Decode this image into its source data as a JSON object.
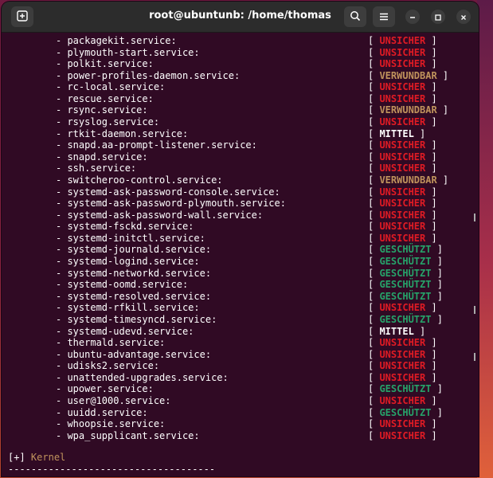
{
  "window": {
    "title": "root@ubuntunb: /home/thomas"
  },
  "icons": {
    "new_tab": "new-tab-icon",
    "search": "search-icon",
    "menu": "hamburger-menu-icon",
    "minimize": "minimize-icon",
    "maximize": "maximize-icon",
    "close": "close-icon"
  },
  "colors": {
    "terminal_bg": "#300a24",
    "unsicher": "#e01b24",
    "verwundbar": "#c0935c",
    "geschuetzt": "#26a269",
    "mittel": "#ffffff"
  },
  "services": [
    {
      "name": "- packagekit.service:",
      "status": "UNSICHER"
    },
    {
      "name": "- plymouth-start.service:",
      "status": "UNSICHER"
    },
    {
      "name": "- polkit.service:",
      "status": "UNSICHER"
    },
    {
      "name": "- power-profiles-daemon.service:",
      "status": "VERWUNDBAR"
    },
    {
      "name": "- rc-local.service:",
      "status": "UNSICHER"
    },
    {
      "name": "- rescue.service:",
      "status": "UNSICHER"
    },
    {
      "name": "- rsync.service:",
      "status": "VERWUNDBAR"
    },
    {
      "name": "- rsyslog.service:",
      "status": "UNSICHER"
    },
    {
      "name": "- rtkit-daemon.service:",
      "status": "MITTEL"
    },
    {
      "name": "- snapd.aa-prompt-listener.service:",
      "status": "UNSICHER"
    },
    {
      "name": "- snapd.service:",
      "status": "UNSICHER"
    },
    {
      "name": "- ssh.service:",
      "status": "UNSICHER"
    },
    {
      "name": "- switcheroo-control.service:",
      "status": "VERWUNDBAR"
    },
    {
      "name": "- systemd-ask-password-console.service:",
      "status": "UNSICHER"
    },
    {
      "name": "- systemd-ask-password-plymouth.service:",
      "status": "UNSICHER"
    },
    {
      "name": "- systemd-ask-password-wall.service:",
      "status": "UNSICHER"
    },
    {
      "name": "- systemd-fsckd.service:",
      "status": "UNSICHER"
    },
    {
      "name": "- systemd-initctl.service:",
      "status": "UNSICHER"
    },
    {
      "name": "- systemd-journald.service:",
      "status": "GESCHÜTZT"
    },
    {
      "name": "- systemd-logind.service:",
      "status": "GESCHÜTZT"
    },
    {
      "name": "- systemd-networkd.service:",
      "status": "GESCHÜTZT"
    },
    {
      "name": "- systemd-oomd.service:",
      "status": "GESCHÜTZT"
    },
    {
      "name": "- systemd-resolved.service:",
      "status": "GESCHÜTZT"
    },
    {
      "name": "- systemd-rfkill.service:",
      "status": "UNSICHER"
    },
    {
      "name": "- systemd-timesyncd.service:",
      "status": "GESCHÜTZT"
    },
    {
      "name": "- systemd-udevd.service:",
      "status": "MITTEL"
    },
    {
      "name": "- thermald.service:",
      "status": "UNSICHER"
    },
    {
      "name": "- ubuntu-advantage.service:",
      "status": "UNSICHER"
    },
    {
      "name": "- udisks2.service:",
      "status": "UNSICHER"
    },
    {
      "name": "- unattended-upgrades.service:",
      "status": "UNSICHER"
    },
    {
      "name": "- upower.service:",
      "status": "GESCHÜTZT"
    },
    {
      "name": "- user@1000.service:",
      "status": "UNSICHER"
    },
    {
      "name": "- uuidd.service:",
      "status": "GESCHÜTZT"
    },
    {
      "name": "- whoopsie.service:",
      "status": "UNSICHER"
    },
    {
      "name": "- wpa_supplicant.service:",
      "status": "UNSICHER"
    }
  ],
  "section": {
    "prefix": "[+]",
    "label": "Kernel",
    "separator": "------------------------------------"
  }
}
